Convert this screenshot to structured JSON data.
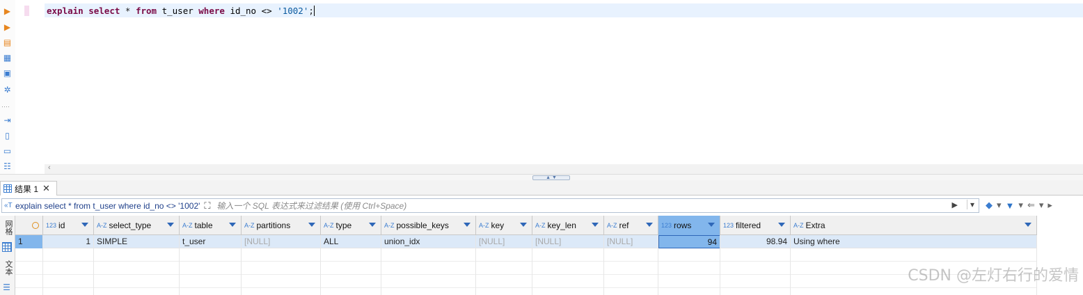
{
  "editor": {
    "sql_tokens": [
      {
        "text": "explain",
        "kind": "kw"
      },
      {
        "text": " ",
        "kind": "op"
      },
      {
        "text": "select",
        "kind": "kw"
      },
      {
        "text": " * ",
        "kind": "op"
      },
      {
        "text": "from",
        "kind": "kw"
      },
      {
        "text": " t_user ",
        "kind": "id"
      },
      {
        "text": "where",
        "kind": "kw"
      },
      {
        "text": " id_no <> ",
        "kind": "id"
      },
      {
        "text": "'1002'",
        "kind": "str"
      },
      {
        "text": ";",
        "kind": "op"
      }
    ]
  },
  "left_toolbar": {
    "icons": [
      "run-statement-icon",
      "run-script-icon",
      "explain-plan-icon",
      "load-script-icon",
      "console-icon",
      "settings-icon",
      "export-icon",
      "new-script-icon",
      "format-icon",
      "outline-icon"
    ]
  },
  "results": {
    "tab_label": "结果 1",
    "filter": {
      "query_text": "explain select * from t_user where id_no <> '1002'",
      "placeholder": "输入一个 SQL 表达式来过滤结果 (使用 Ctrl+Space)"
    },
    "side_tabs": {
      "grid": "网格",
      "text": "文本"
    },
    "columns": [
      {
        "name": "id",
        "type": "123"
      },
      {
        "name": "select_type",
        "type": "A-Z"
      },
      {
        "name": "table",
        "type": "A-Z"
      },
      {
        "name": "partitions",
        "type": "A-Z"
      },
      {
        "name": "type",
        "type": "A-Z"
      },
      {
        "name": "possible_keys",
        "type": "A-Z"
      },
      {
        "name": "key",
        "type": "A-Z"
      },
      {
        "name": "key_len",
        "type": "A-Z"
      },
      {
        "name": "ref",
        "type": "A-Z"
      },
      {
        "name": "rows",
        "type": "123"
      },
      {
        "name": "filtered",
        "type": "123"
      },
      {
        "name": "Extra",
        "type": "A-Z"
      }
    ],
    "rows": [
      {
        "row_number": "1",
        "cells": [
          "1",
          "SIMPLE",
          "t_user",
          "[NULL]",
          "ALL",
          "union_idx",
          "[NULL]",
          "[NULL]",
          "[NULL]",
          "94",
          "98.94",
          "Using where"
        ]
      }
    ],
    "selected_column": "rows"
  },
  "watermark": "CSDN @左灯右行的爱情"
}
